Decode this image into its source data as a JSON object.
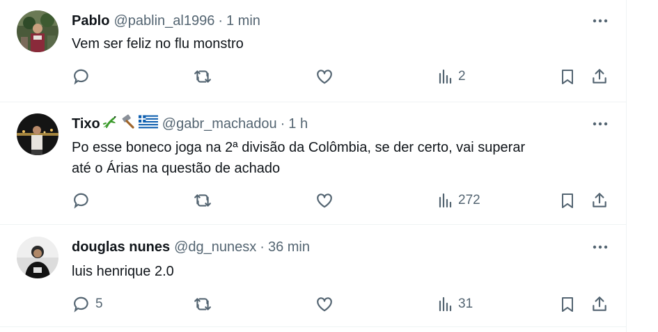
{
  "tweets": [
    {
      "name": "Pablo",
      "handle": "@pablin_al1996",
      "separator": "·",
      "time": "1 min",
      "text_lines": [
        "Vem ser feliz no flu monstro"
      ],
      "reply_count": "",
      "views": "2"
    },
    {
      "name": "Tixo",
      "name_emojis": [
        "lizard",
        "hammer",
        "greece-flag"
      ],
      "handle": "@gabr_machadou",
      "separator": "·",
      "time": "1 h",
      "text_lines": [
        "Po esse boneco joga na 2ª divisão da Colômbia, se der certo, vai superar",
        "até o Árias na questão de achado"
      ],
      "reply_count": "",
      "views": "272"
    },
    {
      "name": "douglas nunes",
      "handle": "@dg_nunesx",
      "separator": "·",
      "time": "36 min",
      "text_lines": [
        "luis henrique 2.0"
      ],
      "reply_count": "5",
      "views": "31"
    }
  ],
  "colors": {
    "text": "#0f1419",
    "secondary": "#536471",
    "divider": "#eff3f4",
    "greek_blue": "#0d5eaf",
    "lizard_green": "#3a9a2a"
  }
}
